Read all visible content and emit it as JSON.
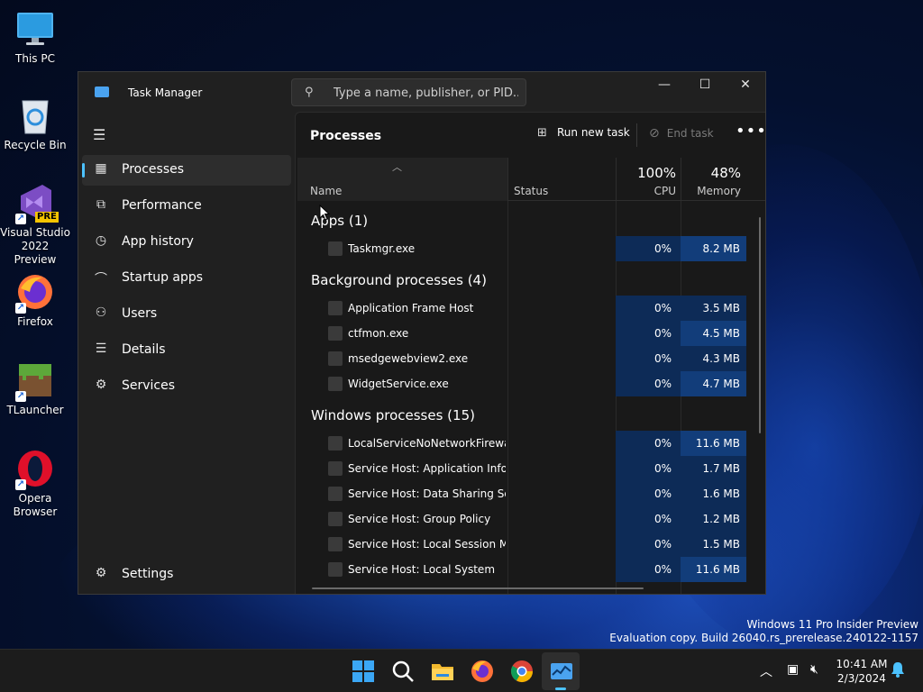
{
  "desktop": {
    "icons": [
      {
        "label": "This PC"
      },
      {
        "label": "Recycle Bin"
      },
      {
        "label": "Visual Studio 2022 Preview",
        "badge": "PRE"
      },
      {
        "label": "Firefox"
      },
      {
        "label": "TLauncher"
      },
      {
        "label": "Opera Browser"
      }
    ],
    "watermark_line1": "Windows 11 Pro Insider Preview",
    "watermark_line2": "Evaluation copy. Build 26040.rs_prerelease.240122-1157"
  },
  "window": {
    "title": "Task Manager",
    "search_placeholder": "Type a name, publisher, or PID..."
  },
  "sidebar": {
    "items": [
      {
        "label": "Processes",
        "icon": "processes-icon"
      },
      {
        "label": "Performance",
        "icon": "performance-icon"
      },
      {
        "label": "App history",
        "icon": "app-history-icon"
      },
      {
        "label": "Startup apps",
        "icon": "startup-apps-icon"
      },
      {
        "label": "Users",
        "icon": "users-icon"
      },
      {
        "label": "Details",
        "icon": "details-icon"
      },
      {
        "label": "Services",
        "icon": "services-icon"
      }
    ],
    "settings_label": "Settings"
  },
  "toolbar": {
    "page_title": "Processes",
    "run_new_task": "Run new task",
    "end_task": "End task",
    "more": "•••"
  },
  "table": {
    "name_header": "Name",
    "status_header": "Status",
    "cpu_percent": "100%",
    "cpu_header": "CPU",
    "memory_percent": "48%",
    "memory_header": "Memory",
    "groups": {
      "apps": "Apps (1)",
      "background": "Background processes (4)",
      "windows": "Windows processes (15)"
    },
    "rows": [
      {
        "name": "Taskmgr.exe",
        "cpu": "0%",
        "memory": "8.2 MB"
      },
      {
        "name": "Application Frame Host",
        "cpu": "0%",
        "memory": "3.5 MB"
      },
      {
        "name": "ctfmon.exe",
        "cpu": "0%",
        "memory": "4.5 MB"
      },
      {
        "name": "msedgewebview2.exe",
        "cpu": "0%",
        "memory": "4.3 MB"
      },
      {
        "name": "WidgetService.exe",
        "cpu": "0%",
        "memory": "4.7 MB"
      },
      {
        "name": "LocalServiceNoNetworkFirewall",
        "cpu": "0%",
        "memory": "11.6 MB"
      },
      {
        "name": "Service Host: Application Infor...",
        "cpu": "0%",
        "memory": "1.7 MB"
      },
      {
        "name": "Service Host: Data Sharing Ser...",
        "cpu": "0%",
        "memory": "1.6 MB"
      },
      {
        "name": "Service Host: Group Policy",
        "cpu": "0%",
        "memory": "1.2 MB"
      },
      {
        "name": "Service Host: Local Session M...",
        "cpu": "0%",
        "memory": "1.5 MB"
      },
      {
        "name": "Service Host: Local System",
        "cpu": "0%",
        "memory": "11.6 MB"
      }
    ]
  },
  "taskbar": {
    "time": "10:41 AM",
    "date": "2/3/2024"
  },
  "colors": {
    "accent": "#4cc2ff",
    "heat_low": "#0d2b57",
    "heat_high": "#123d7a"
  }
}
